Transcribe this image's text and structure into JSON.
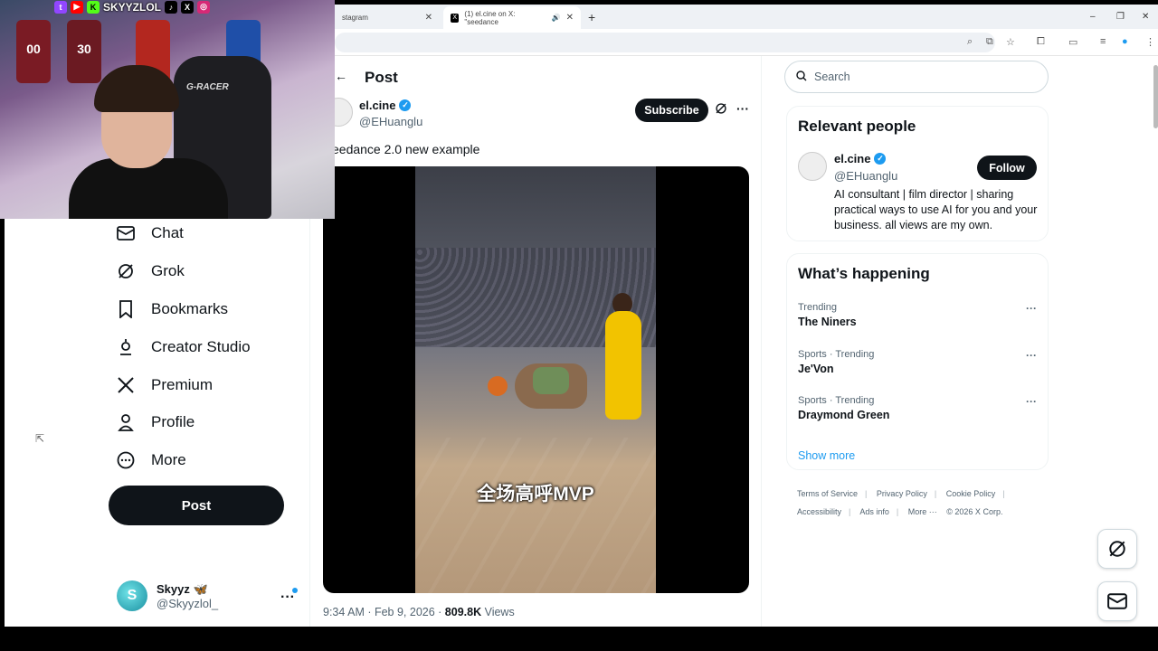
{
  "browser": {
    "tabs": [
      {
        "title": "stagram",
        "active": false
      },
      {
        "title": "(1) el.cine on X: \"seedance",
        "active": true
      }
    ],
    "new_tab": "+",
    "window_controls": [
      "–",
      "❐",
      "✕"
    ]
  },
  "sidebar": {
    "items": [
      {
        "label": "Chat",
        "icon": "mail-icon"
      },
      {
        "label": "Grok",
        "icon": "grok-icon"
      },
      {
        "label": "Bookmarks",
        "icon": "bookmark-icon"
      },
      {
        "label": "Creator Studio",
        "icon": "creator-studio-icon"
      },
      {
        "label": "Premium",
        "icon": "x-logo-icon"
      },
      {
        "label": "Profile",
        "icon": "person-icon"
      },
      {
        "label": "More",
        "icon": "more-circle-icon"
      }
    ],
    "post_button": "Post",
    "account": {
      "name": "Skyyz 🦋",
      "handle": "@Skyyzlol_"
    }
  },
  "main": {
    "title": "Post",
    "author": {
      "name": "el.cine",
      "handle": "@EHuanglu"
    },
    "subscribe_label": "Subscribe",
    "post_text": "eedance 2.0 new example",
    "video_caption": "全场高呼MVP",
    "timestamp": "9:34 AM · Feb 9, 2026 · ",
    "views_count": "809.8K",
    "views_label": " Views"
  },
  "right": {
    "search_placeholder": "Search",
    "relevant_people": {
      "title": "Relevant people",
      "name": "el.cine",
      "handle": "@EHuanglu",
      "follow_label": "Follow",
      "bio": "AI consultant | film director | sharing practical ways to use AI for you and your business. all views are my own."
    },
    "happening": {
      "title": "What’s happening",
      "trends": [
        {
          "category": "Trending",
          "name": "The Niners"
        },
        {
          "category": "Sports · Trending",
          "name": "Je'Von"
        },
        {
          "category": "Sports · Trending",
          "name": "Draymond Green"
        }
      ],
      "show_more": "Show more"
    },
    "footer": {
      "links": [
        "Terms of Service",
        "Privacy Policy",
        "Cookie Policy",
        "Accessibility",
        "Ads info",
        "More ···"
      ],
      "copyright": "© 2026 X Corp."
    }
  },
  "webcam": {
    "handle": "SKYYZLOL",
    "chair_text": "G-RACER",
    "jersey_numbers": [
      "00",
      "30"
    ]
  },
  "colors": {
    "accent": "#1d9bf0",
    "dark_button": "#0f1419",
    "secondary_text": "#536471"
  }
}
